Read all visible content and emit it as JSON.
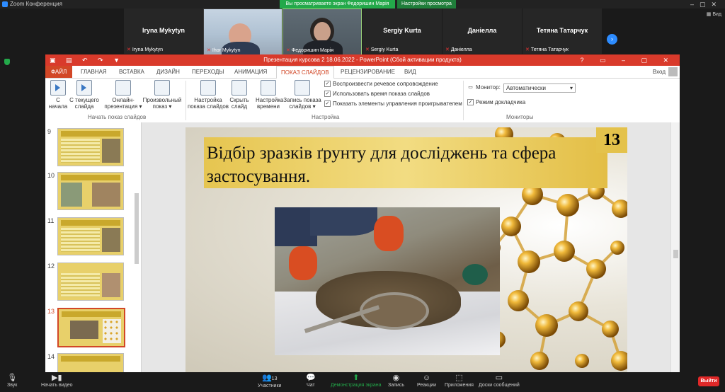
{
  "zoom": {
    "app_title": "Zoom Конференция",
    "share_banner": "Вы просматриваете экран Федоришин Марія",
    "view_options": "Настройки просмотра",
    "view_button": "Вид"
  },
  "participants": [
    {
      "name": "Iryna Mykytyn",
      "label": "Iryna Mykytyn",
      "video": false
    },
    {
      "name": "",
      "label": "Ihor Mykytyn",
      "video": true
    },
    {
      "name": "",
      "label": "Федоришин Марія",
      "video": true
    },
    {
      "name": "Sergiy Kurta",
      "label": "Sergiy Kurta",
      "video": false
    },
    {
      "name": "Даніелла",
      "label": "Даніелла",
      "video": false
    },
    {
      "name": "Тетяна Татарчук",
      "label": "Тетяна Татарчук",
      "video": false
    }
  ],
  "ppt": {
    "title": "Презентация курсова 2 18.06.2022 -  PowerPoint (Сбой активации продукта)",
    "signin": "Вход",
    "tabs": [
      "ФАЙЛ",
      "ГЛАВНАЯ",
      "ВСТАВКА",
      "ДИЗАЙН",
      "ПЕРЕХОДЫ",
      "АНИМАЦИЯ",
      "ПОКАЗ СЛАЙДОВ",
      "РЕЦЕНЗИРОВАНИЕ",
      "ВИД"
    ],
    "ribbon": {
      "from_start_1": "С",
      "from_start_2": "начала",
      "from_current_1": "С текущего",
      "from_current_2": "слайда",
      "online_1": "Онлайн-",
      "online_2": "презентация ▾",
      "custom_1": "Произвольный",
      "custom_2": "показ ▾",
      "group_start": "Начать показ слайдов",
      "setup_1": "Настройка",
      "setup_2": "показа слайдов",
      "hide_1": "Скрыть",
      "hide_2": "слайд",
      "rehearse_1": "Настройка",
      "rehearse_2": "времени",
      "record_1": "Запись показа",
      "record_2": "слайдов ▾",
      "chk_narration": "Воспроизвести речевое сопровождение",
      "chk_timings": "Использовать время показа слайдов",
      "chk_controls": "Показать элементы управления проигрывателем",
      "group_setup": "Настройка",
      "monitor_label": "Монитор:",
      "monitor_value": "Автоматически",
      "presenter_view": "Режим докладчика",
      "group_monitors": "Мониторы"
    },
    "thumbnails": [
      "9",
      "10",
      "11",
      "12",
      "13",
      "14"
    ],
    "selected_thumbnail": "13",
    "slide": {
      "number": "13",
      "title": "Відбір зразків ґрунту для досліджень та сфера застосування."
    }
  },
  "toolbar": {
    "audio": "Звук",
    "video": "Начать видео",
    "participants": "Участники",
    "participants_count": "13",
    "chat": "Чат",
    "share": "Демонстрация экрана",
    "record": "Запись",
    "reactions": "Реакции",
    "apps": "Приложения",
    "whiteboard": "Доски сообщений",
    "leave": "Выйти"
  }
}
